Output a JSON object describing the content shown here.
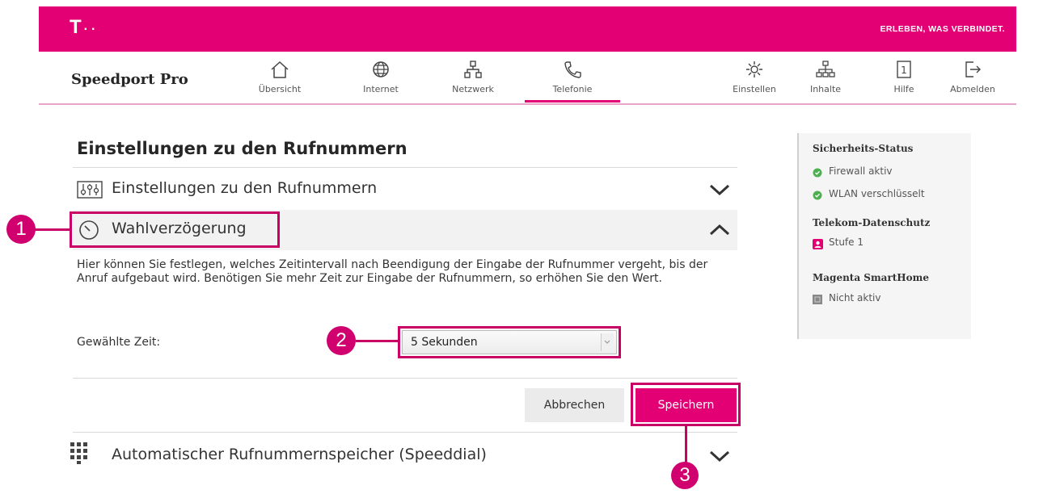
{
  "header": {
    "logo": "T",
    "logo_dots": "··",
    "claim": "ERLEBEN, WAS VERBINDET."
  },
  "app": {
    "title": "Speedport Pro"
  },
  "nav": {
    "items": [
      {
        "label": "Übersicht",
        "icon": "home-icon"
      },
      {
        "label": "Internet",
        "icon": "globe-icon"
      },
      {
        "label": "Netzwerk",
        "icon": "network-icon"
      },
      {
        "label": "Telefonie",
        "icon": "phone-icon",
        "active": true
      }
    ],
    "right_items": [
      {
        "label": "Einstellen",
        "icon": "gear-icon"
      },
      {
        "label": "Inhalte",
        "icon": "sitemap-icon"
      },
      {
        "label": "Hilfe",
        "icon": "help-icon"
      },
      {
        "label": "Abmelden",
        "icon": "logout-icon"
      }
    ]
  },
  "main": {
    "title": "Einstellungen zu den Rufnummern",
    "sections": [
      {
        "title": "Einstellungen zu den Rufnummern",
        "icon": "sliders-icon",
        "expanded": false
      },
      {
        "title": "Wahlverzögerung",
        "icon": "clock-icon",
        "expanded": true
      },
      {
        "title": "Automatischer Rufnummernspeicher (Speeddial)",
        "icon": "keypad-icon",
        "expanded": false
      }
    ],
    "description": "Hier können Sie festlegen, welches Zeitintervall nach Beendigung der Eingabe der Rufnummer vergeht, bis der Anruf aufgebaut wird. Benötigen Sie mehr Zeit zur Eingabe der Rufnummern, so erhöhen Sie den Wert.",
    "field_label": "Gewählte Zeit:",
    "selected_time": "5 Sekunden",
    "cancel_label": "Abbrechen",
    "save_label": "Speichern"
  },
  "callouts": [
    "1",
    "2",
    "3"
  ],
  "sidebar": {
    "security_title": "Sicherheits-Status",
    "firewall": "Firewall aktiv",
    "wlan": "WLAN verschlüsselt",
    "privacy_title": "Telekom-Datenschutz",
    "privacy_level": "Stufe 1",
    "smarthome_title": "Magenta SmartHome",
    "smarthome_status": "Nicht aktiv"
  },
  "colors": {
    "brand": "#e20074",
    "status_ok": "#4caf50",
    "callout": "#d0006f"
  }
}
